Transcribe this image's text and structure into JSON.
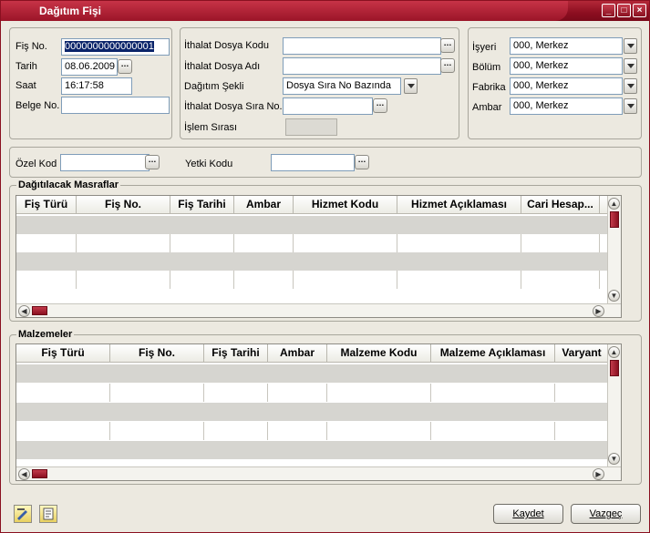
{
  "window": {
    "title": "Dağıtım Fişi"
  },
  "header_left": {
    "fis_no_label": "Fiş No.",
    "fis_no_value": "0000000000000001",
    "tarih_label": "Tarih",
    "tarih_value": "08.06.2009",
    "saat_label": "Saat",
    "saat_value": "16:17:58",
    "belge_no_label": "Belge No.",
    "belge_no_value": ""
  },
  "header_mid": {
    "ithalat_dosya_kodu_label": "İthalat Dosya Kodu",
    "ithalat_dosya_adi_label": "İthalat Dosya Adı",
    "dagitim_sekli_label": "Dağıtım Şekli",
    "dagitim_sekli_value": "Dosya Sıra No Bazında",
    "ithalat_dosya_sira_label": "İthalat Dosya Sıra No.",
    "islem_sirasi_label": "İşlem Sırası"
  },
  "header_right": {
    "isyeri_label": "İşyeri",
    "isyeri_value": "000, Merkez",
    "bolum_label": "Bölüm",
    "bolum_value": "000, Merkez",
    "fabrika_label": "Fabrika",
    "fabrika_value": "000, Merkez",
    "ambar_label": "Ambar",
    "ambar_value": "000, Merkez"
  },
  "codes": {
    "ozel_kod_label": "Özel Kod",
    "yetki_kodu_label": "Yetki Kodu"
  },
  "expenses": {
    "title": "Dağıtılacak Masraflar",
    "columns": [
      "Fiş Türü",
      "Fiş No.",
      "Fiş Tarihi",
      "Ambar",
      "Hizmet Kodu",
      "Hizmet Açıklaması",
      "Cari Hesap..."
    ]
  },
  "materials": {
    "title": "Malzemeler",
    "columns": [
      "Fiş Türü",
      "Fiş No.",
      "Fiş Tarihi",
      "Ambar",
      "Malzeme Kodu",
      "Malzeme Açıklaması",
      "Varyant"
    ]
  },
  "footer": {
    "save_label": "Kaydet",
    "cancel_label": "Vazgeç"
  }
}
